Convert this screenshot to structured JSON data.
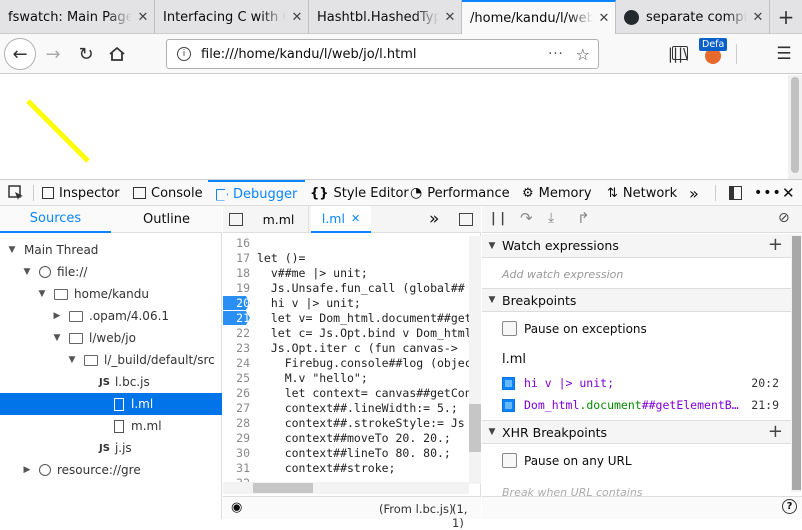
{
  "browser": {
    "tabs": [
      {
        "title": "fswatch: Main Page"
      },
      {
        "title": "Interfacing C with OCaml"
      },
      {
        "title": "Hashtbl.HashedType"
      },
      {
        "title": "/home/kandu/l/web/jo/l.html"
      },
      {
        "title": "separate compilation"
      }
    ],
    "url": "file:///home/kandu/l/web/jo/l.html",
    "badge": "Defa"
  },
  "devtools": {
    "tabs": [
      "Inspector",
      "Console",
      "Debugger",
      "Style Editor",
      "Performance",
      "Memory",
      "Network"
    ],
    "selected_tab": "Debugger"
  },
  "sources": {
    "tabs": [
      "Sources",
      "Outline"
    ],
    "tree": [
      {
        "label": "Main Thread",
        "kind": "thread",
        "depth": 0,
        "arrow": "down"
      },
      {
        "label": "file://",
        "kind": "globe",
        "depth": 1,
        "arrow": "down"
      },
      {
        "label": "home/kandu",
        "kind": "folder",
        "depth": 2,
        "arrow": "down"
      },
      {
        "label": ".opam/4.06.1",
        "kind": "folder",
        "depth": 3,
        "arrow": "right"
      },
      {
        "label": "l/web/jo",
        "kind": "folder",
        "depth": 3,
        "arrow": "down"
      },
      {
        "label": "l/_build/default/src",
        "kind": "folder",
        "depth": 4,
        "arrow": "down"
      },
      {
        "label": "l.bc.js",
        "kind": "js",
        "depth": 5,
        "arrow": ""
      },
      {
        "label": "l.ml",
        "kind": "file",
        "depth": 6,
        "arrow": "",
        "selected": true
      },
      {
        "label": "m.ml",
        "kind": "file",
        "depth": 6,
        "arrow": ""
      },
      {
        "label": "j.js",
        "kind": "js",
        "depth": 5,
        "arrow": ""
      },
      {
        "label": "resource://gre",
        "kind": "globe",
        "depth": 1,
        "arrow": "right"
      }
    ]
  },
  "editor": {
    "tabs": [
      "m.ml",
      "l.ml"
    ],
    "active_tab": "l.ml",
    "lines": [
      {
        "n": "16",
        "code": ""
      },
      {
        "n": "17",
        "code": "let ()="
      },
      {
        "n": "18",
        "code": "  v##me |> unit;"
      },
      {
        "n": "19",
        "code": "  Js.Unsafe.fun_call (global##"
      },
      {
        "n": "20",
        "code": "  hi v |> unit;",
        "bp": true
      },
      {
        "n": "21",
        "code": "  let v= Dom_html.document##get",
        "bp": true
      },
      {
        "n": "22",
        "code": "  let c= Js.Opt.bind v Dom_html"
      },
      {
        "n": "23",
        "code": "  Js.Opt.iter c (fun canvas->"
      },
      {
        "n": "24",
        "code": "    Firebug.console##log (objec"
      },
      {
        "n": "25",
        "code": "    M.v \"hello\";"
      },
      {
        "n": "26",
        "code": "    let context= canvas##getCon"
      },
      {
        "n": "27",
        "code": "    context##.lineWidth:= 5.;"
      },
      {
        "n": "28",
        "code": "    context##.strokeStyle:= Js"
      },
      {
        "n": "29",
        "code": "    context##moveTo 20. 20.;"
      },
      {
        "n": "30",
        "code": "    context##lineTo 80. 80.;"
      },
      {
        "n": "31",
        "code": "    context##stroke;"
      },
      {
        "n": "32",
        "code": ""
      }
    ],
    "footer": "(From l.bc.js)",
    "position": "(1, 1)"
  },
  "panel": {
    "watch_title": "Watch expressions",
    "watch_placeholder": "Add watch expression",
    "breakpoints_title": "Breakpoints",
    "pause_exceptions": "Pause on exceptions",
    "bp_file": "l.ml",
    "bp1_code": "hi v |> unit;",
    "bp1_loc": "20:2",
    "bp2_code_a": "Dom_html",
    "bp2_code_b": ".document",
    "bp2_code_c": "##getElementB…",
    "bp2_loc": "21:9",
    "xhr_title": "XHR Breakpoints",
    "pause_url": "Pause on any URL",
    "break_url_placeholder": "Break when URL contains"
  }
}
